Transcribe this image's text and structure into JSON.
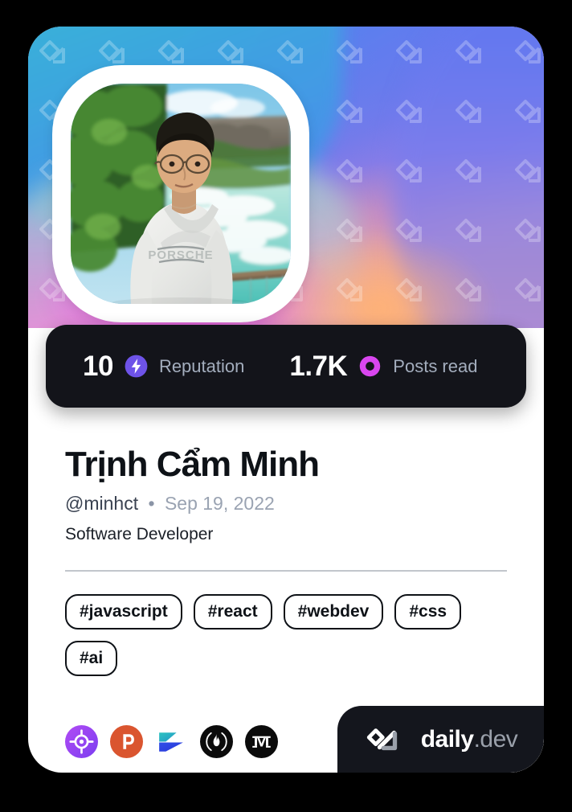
{
  "card": {
    "accent_gradient": [
      "#3fb3d6",
      "#4f86ee",
      "#7b7ce8",
      "#b37ee0",
      "#e8a7c8",
      "#f0b98f"
    ],
    "stats_bar_color": "#13141a",
    "brand_badge_color": "#14161d"
  },
  "avatar": {
    "alt": "profile-photo",
    "description": "Person with glasses in white PORSCHE t-shirt standing by a turquoise river with trees and cliffs"
  },
  "stats": [
    {
      "value": "10",
      "label": "Reputation",
      "icon": "lightning-bolt-icon",
      "icon_color": "#6e53e8"
    },
    {
      "value": "1.7K",
      "label": "Posts read",
      "icon": "eye-ring-icon",
      "icon_color": "#d946ef"
    }
  ],
  "profile": {
    "name": "Trịnh Cẩm Minh",
    "handle": "@minhct",
    "separator": "•",
    "joined_date": "Sep 19, 2022",
    "role": "Software Developer"
  },
  "tags": [
    "#javascript",
    "#react",
    "#webdev",
    "#css",
    "#ai"
  ],
  "socials": [
    {
      "name": "roadmap-icon",
      "title": "roadmap.sh"
    },
    {
      "name": "product-hunt-icon",
      "title": "Product Hunt"
    },
    {
      "name": "showwcase-icon",
      "title": "Showwcase"
    },
    {
      "name": "hashnode-flame-icon",
      "title": "Hashnode"
    },
    {
      "name": "medium-icon",
      "title": "Medium"
    }
  ],
  "brand": {
    "logo_icon": "daily-dev-logo-icon",
    "name": "daily",
    "suffix": ".dev"
  }
}
